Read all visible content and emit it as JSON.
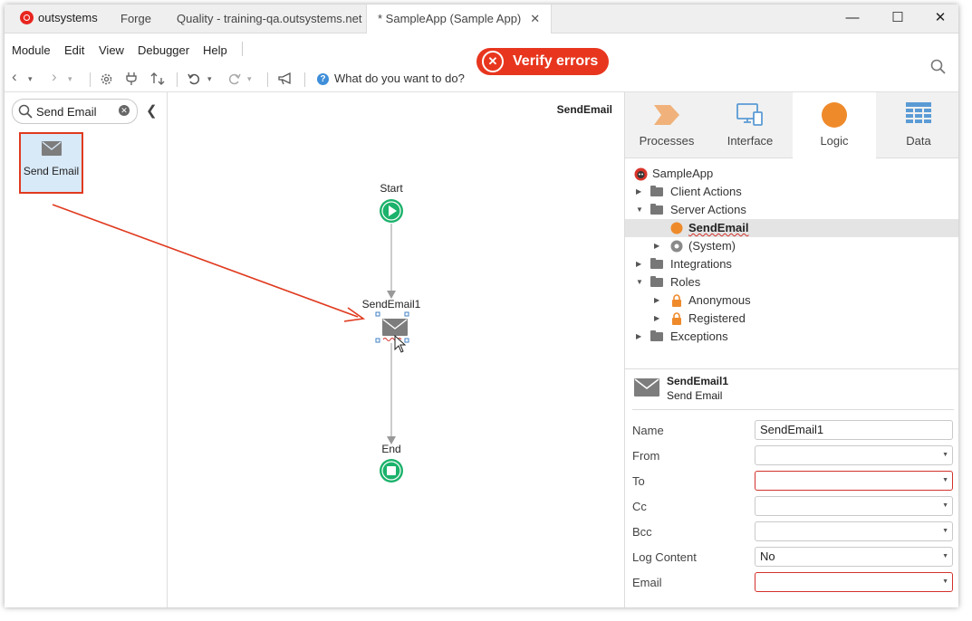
{
  "titlebar": {
    "logo_text": "outsystems",
    "tabs": [
      {
        "label": "Forge"
      },
      {
        "label": "Quality - training-qa.outsystems.net"
      },
      {
        "label": "* SampleApp (Sample App)",
        "close": "✕"
      }
    ],
    "minimize": "—",
    "maximize": "☐",
    "close": "✕"
  },
  "menu": [
    "Module",
    "Edit",
    "View",
    "Debugger",
    "Help"
  ],
  "toolbar": {
    "back": "‹",
    "forward": "›",
    "dropdown": "▾",
    "settings_icon": "gear-icon",
    "help_text": "What do you want to do?",
    "search_icon": "search-icon"
  },
  "verify": {
    "label": "Verify errors",
    "color": "#e8361e"
  },
  "left": {
    "search_value": "Send Email",
    "tool_label": "Send Email"
  },
  "canvas": {
    "title": "SendEmail",
    "start_label": "Start",
    "node_label": "SendEmail1",
    "end_label": "End",
    "start_color": "#1bb26b"
  },
  "right": {
    "tabs": [
      {
        "label": "Processes",
        "icon": "processes-icon"
      },
      {
        "label": "Interface",
        "icon": "interface-icon"
      },
      {
        "label": "Logic",
        "icon": "logic-icon"
      },
      {
        "label": "Data",
        "icon": "data-icon"
      }
    ],
    "tree": {
      "root": "SampleApp",
      "client_actions": "Client Actions",
      "server_actions": "Server Actions",
      "send_email": "SendEmail",
      "system": "(System)",
      "integrations": "Integrations",
      "roles": "Roles",
      "anonymous": "Anonymous",
      "registered": "Registered",
      "exceptions": "Exceptions"
    },
    "props": {
      "title": "SendEmail1",
      "subtitle": "Send Email",
      "fields": [
        {
          "label": "Name",
          "value": "SendEmail1",
          "error": false
        },
        {
          "label": "From",
          "value": "",
          "error": false
        },
        {
          "label": "To",
          "value": "",
          "error": true
        },
        {
          "label": "Cc",
          "value": "",
          "error": false
        },
        {
          "label": "Bcc",
          "value": "",
          "error": false
        },
        {
          "label": "Log Content",
          "value": "No",
          "error": false
        },
        {
          "label": "Email",
          "value": "",
          "error": true
        }
      ]
    }
  }
}
